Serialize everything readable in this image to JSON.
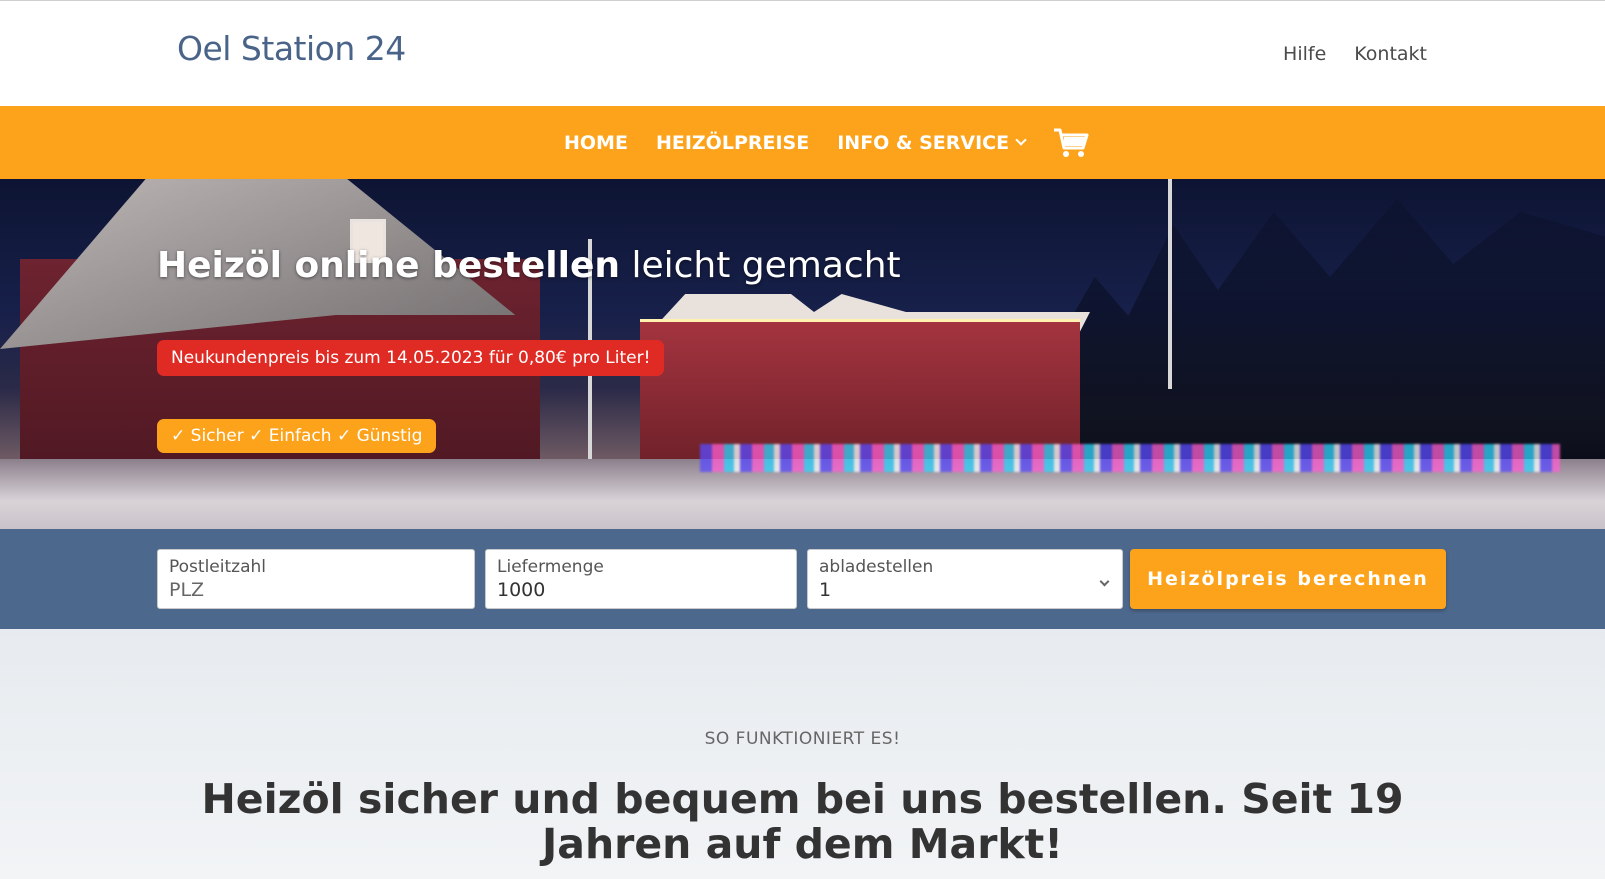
{
  "header": {
    "logo": "Oel Station 24",
    "links": [
      "Hilfe",
      "Kontakt"
    ]
  },
  "nav": {
    "items": [
      "HOME",
      "HEIZÖLPREISE",
      "INFO & SERVICE"
    ],
    "cart_icon": "cart-icon",
    "dropdown_icon": "chevron-down-icon",
    "color": "#fda31b"
  },
  "hero": {
    "title_bold": "Heizöl online bestellen",
    "title_light": "leicht gemacht",
    "badge_red": "Neukundenpreis bis zum 14.05.2023 für 0,80€ pro Liter!",
    "badge_orange": "✓ Sicher ✓ Einfach ✓ Günstig"
  },
  "form": {
    "plz_label": "Postleitzahl",
    "plz_placeholder": "PLZ",
    "menge_label": "Liefermenge",
    "menge_value": "1000",
    "stellen_label": "abladestellen",
    "stellen_value": "1",
    "submit_label": "Heizölpreis berechnen",
    "bar_color": "#4d688d"
  },
  "section": {
    "label": "SO FUNKTIONIERT ES!",
    "heading": "Heizöl  sicher und bequem bei uns bestellen. Seit 19 Jahren auf dem Markt!"
  }
}
